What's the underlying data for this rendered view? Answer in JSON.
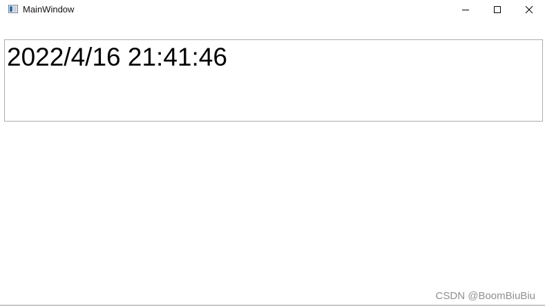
{
  "window": {
    "title": "MainWindow",
    "icon": "app-window-icon",
    "controls": {
      "minimize_icon": "minimize-icon",
      "maximize_icon": "maximize-icon",
      "close_icon": "close-icon"
    }
  },
  "content": {
    "datetime_text": "2022/4/16 21:41:46"
  },
  "watermark": {
    "text": "CSDN @BoomBiuBiu"
  }
}
